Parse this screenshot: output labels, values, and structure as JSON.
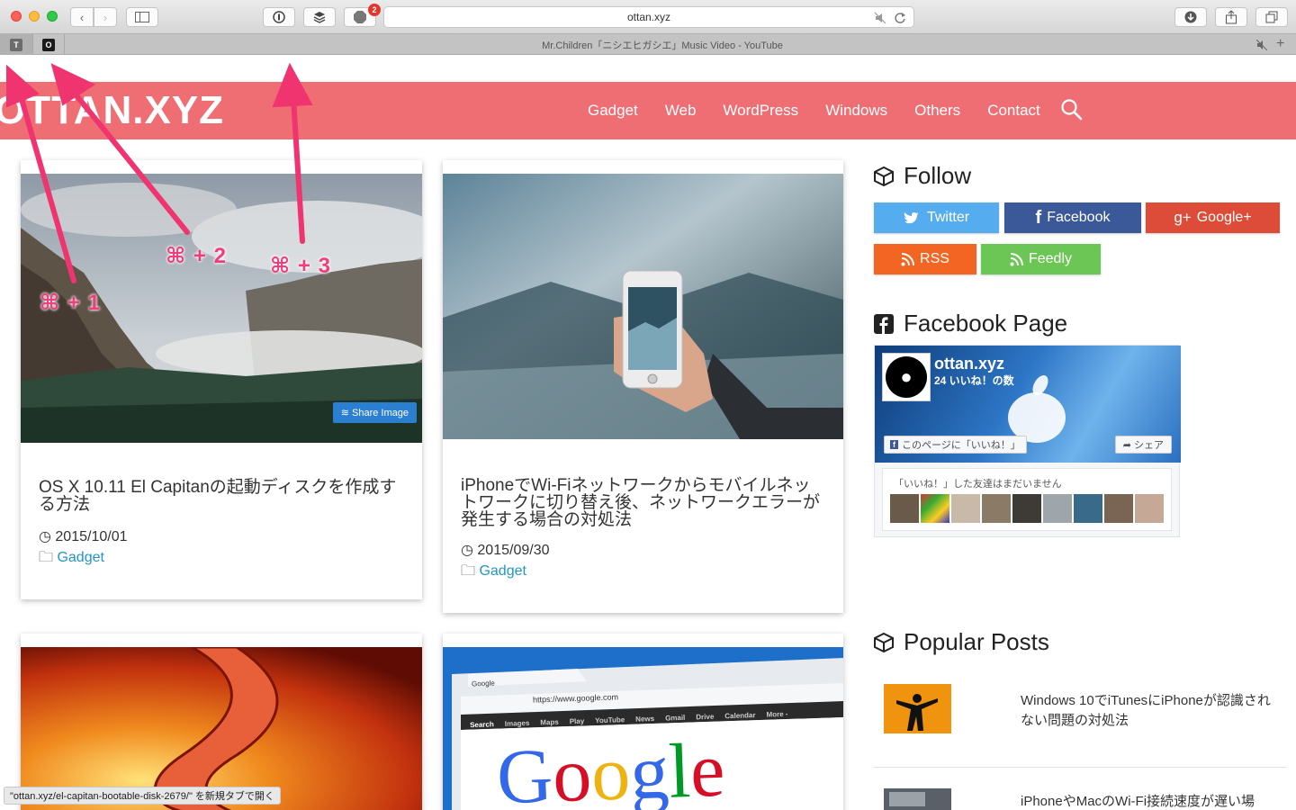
{
  "browser": {
    "address": "ottan.xyz",
    "abp_badge": "2",
    "abp_label": "ABP",
    "pinned_tabs": [
      {
        "letter": "T",
        "color": "#6c6c6c"
      },
      {
        "letter": "O",
        "color": "#1b1b1b"
      }
    ],
    "active_tab_title": "Mr.Children「ニシエヒガシエ」Music Video - YouTube",
    "status_text": "\"ottan.xyz/el-capitan-bootable-disk-2679/\" を新規タブで開く"
  },
  "annotations": [
    "⌘ + 1",
    "⌘ + 2",
    "⌘ + 3"
  ],
  "site": {
    "logo": "OTTAN.XYZ",
    "accent_color": "#ee6e73",
    "nav": [
      "Gadget",
      "Web",
      "WordPress",
      "Windows",
      "Others",
      "Contact"
    ]
  },
  "posts": [
    {
      "title": "OS X 10.11 El Capitanの起動ディスクを作成する方法",
      "date": "2015/10/01",
      "category": "Gadget",
      "share_label": "Share Image"
    },
    {
      "title": "iPhoneでWi-Fiネットワークからモバイルネットワークに切り替え後、ネットワークエラーが発生する場合の対処法",
      "date": "2015/09/30",
      "category": "Gadget"
    }
  ],
  "google_thumb": {
    "tab": "Google",
    "url": "https://www.google.com",
    "menu": [
      "Search",
      "Images",
      "Maps",
      "Play",
      "YouTube",
      "News",
      "Gmail",
      "Drive",
      "Calendar",
      "More -"
    ],
    "logo": "Google"
  },
  "sidebar": {
    "follow_heading": "Follow",
    "buttons": [
      {
        "label": "Twitter",
        "color": "#55acee"
      },
      {
        "label": "Facebook",
        "color": "#3b5998"
      },
      {
        "label": "Google+",
        "color": "#dd4b39"
      },
      {
        "label": "RSS",
        "color": "#f26522"
      },
      {
        "label": "Feedly",
        "color": "#6cc655"
      }
    ],
    "facebook_heading": "Facebook Page",
    "fb_page_name": "ottan.xyz",
    "fb_likes": "24 いいね！の数",
    "fb_like_button": "このページに「いいね！」",
    "fb_share_button": "シェア",
    "fb_friends_text": "「いいね！」した友達はまだいません",
    "popular_heading": "Popular Posts",
    "popular_posts": [
      {
        "title": "Windows 10でiTunesにiPhoneが認識されない問題の対処法"
      },
      {
        "title": "iPhoneやMacのWi-Fi接続速度が遅い場"
      }
    ]
  }
}
